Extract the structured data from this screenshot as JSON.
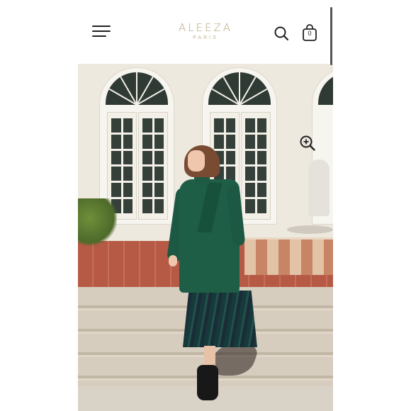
{
  "header": {
    "brand_name": "ALEEZA",
    "brand_sub": "PARIS",
    "menu_icon": "hamburger-menu-icon",
    "search_icon": "search-icon",
    "cart_icon": "shopping-bag-icon",
    "cart_count": "0"
  },
  "hero": {
    "zoom_icon": "zoom-in-icon",
    "colors": {
      "coat": "#1e5e46",
      "brand_gold": "#b8a47a"
    }
  }
}
